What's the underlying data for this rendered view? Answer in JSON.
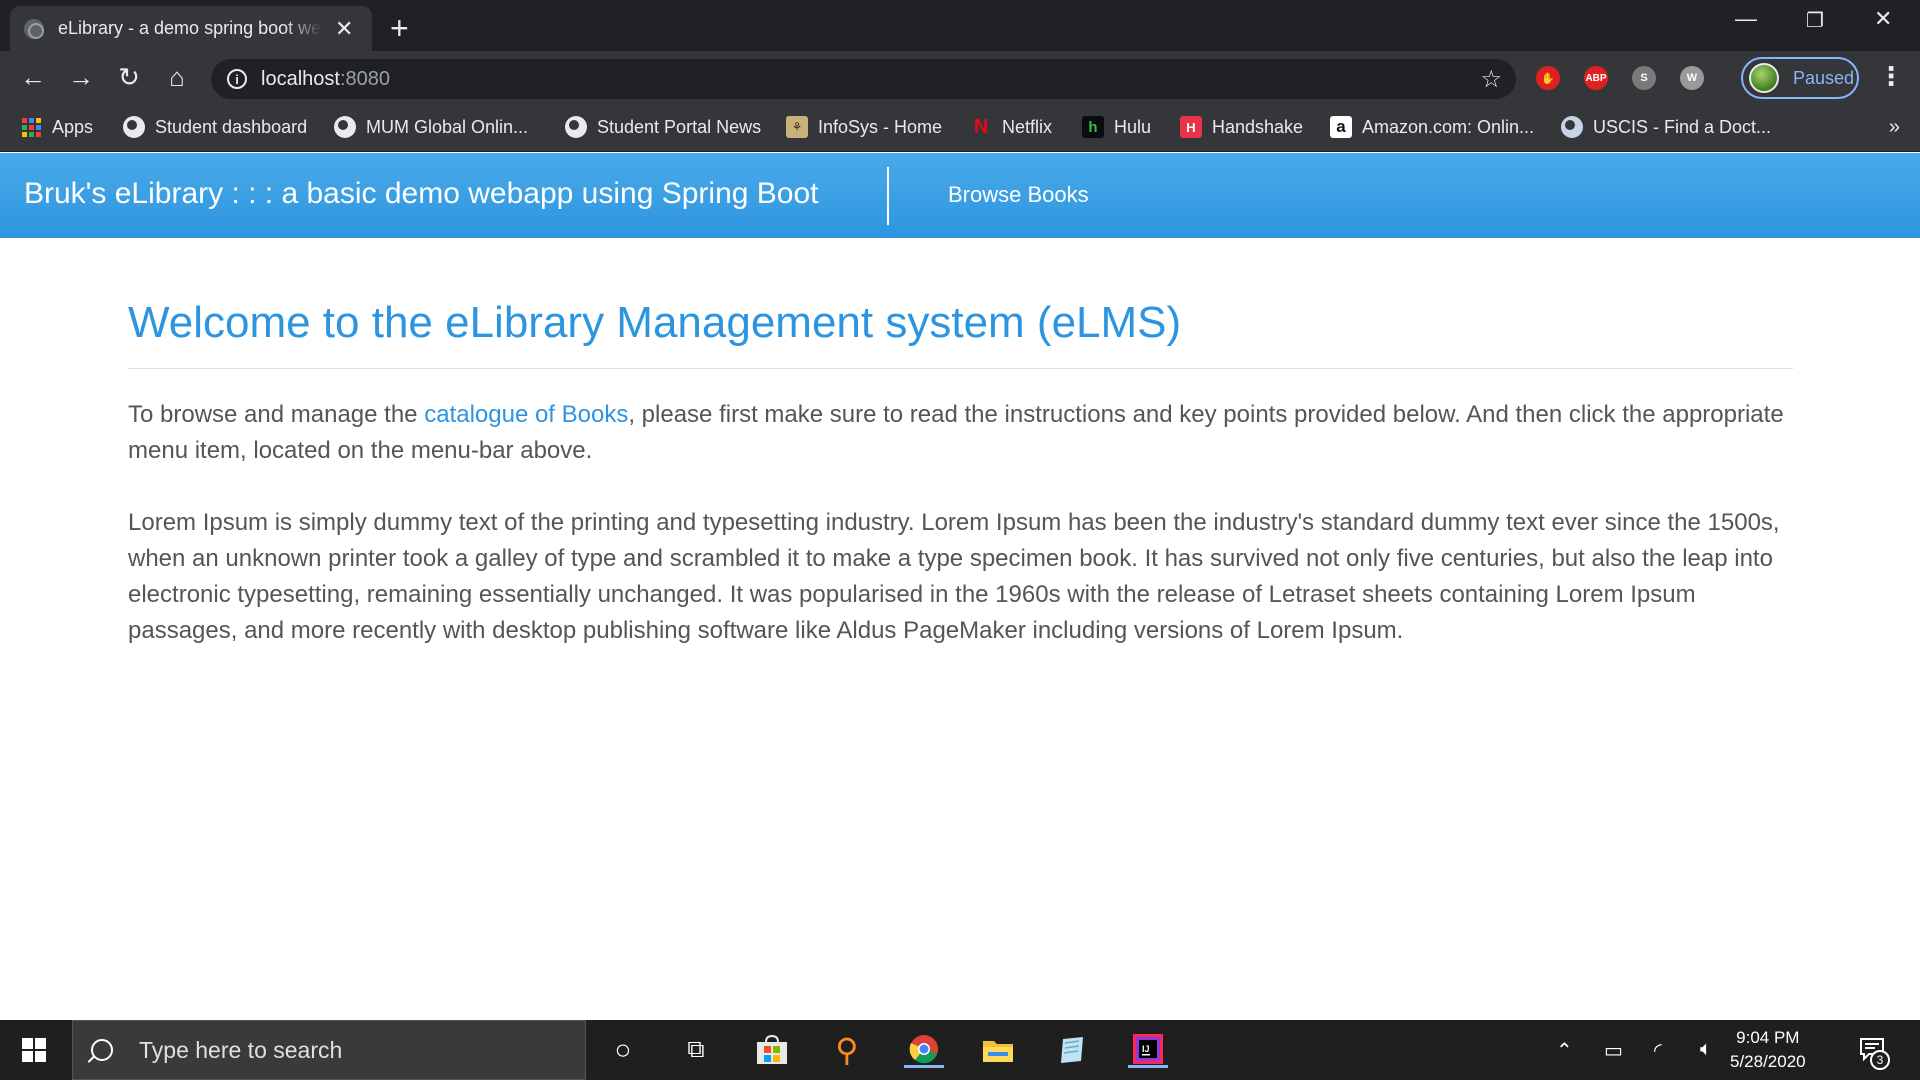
{
  "browser": {
    "tab_title": "eLibrary - a demo spring boot web app",
    "tab_close": "✕",
    "new_tab": "+",
    "window_controls": {
      "minimize": "—",
      "restore": "❐",
      "close": "✕"
    },
    "toolbar": {
      "back": "←",
      "forward": "→",
      "reload": "↻",
      "home": "⌂",
      "info_glyph": "i",
      "url_host": "localhost",
      "url_port": ":8080",
      "star": "☆",
      "extensions": [
        {
          "icon": "hand-stop-icon",
          "label": "",
          "color": "#e02020"
        },
        {
          "icon": "adblock-plus-icon",
          "label": "ABP",
          "color": "#e02020"
        },
        {
          "icon": "s-extension-icon",
          "label": "S",
          "color": "#7a7a7a"
        },
        {
          "icon": "w-extension-icon",
          "label": "W",
          "color": "#9a9a9a"
        }
      ],
      "profile_status": "Paused",
      "menu": "⋮"
    },
    "bookmarks": {
      "items": [
        {
          "label": "Apps",
          "icon": "apps-grid-icon"
        },
        {
          "label": "Student dashboard",
          "icon": "globe-icon"
        },
        {
          "label": "MUM Global Onlin...",
          "icon": "globe-icon"
        },
        {
          "label": "Student Portal News",
          "icon": "globe-icon"
        },
        {
          "label": "InfoSys - Home",
          "icon": "infosys-icon"
        },
        {
          "label": "Netflix",
          "icon": "netflix-icon"
        },
        {
          "label": "Hulu",
          "icon": "hulu-icon"
        },
        {
          "label": "Handshake",
          "icon": "handshake-icon"
        },
        {
          "label": "Amazon.com: Onlin...",
          "icon": "amazon-icon"
        },
        {
          "label": "USCIS - Find a Doct...",
          "icon": "uscis-icon"
        }
      ],
      "more": "»"
    }
  },
  "site": {
    "brand": "Bruk's eLibrary : : : a basic demo webapp using Spring Boot",
    "nav_link": "Browse Books",
    "heading": "Welcome to the eLibrary Management system (eLMS)",
    "intro_before": "To browse and manage the ",
    "intro_link": "catalogue of Books",
    "intro_after": ", please first make sure to read the instructions and key points provided below. And then click the appropriate menu item, located on the menu-bar above.",
    "lorem": "Lorem Ipsum is simply dummy text of the printing and typesetting industry. Lorem Ipsum has been the industry's standard dummy text ever since the 1500s, when an unknown printer took a galley of type and scrambled it to make a type specimen book. It has survived not only five centuries, but also the leap into electronic typesetting, remaining essentially unchanged. It was popularised in the 1960s with the release of Letraset sheets containing Lorem Ipsum passages, and more recently with desktop publishing software like Aldus PageMaker including versions of Lorem Ipsum."
  },
  "taskbar": {
    "search_placeholder": "Type here to search",
    "time": "9:04 PM",
    "date": "5/28/2020",
    "notification_count": "3"
  },
  "colors": {
    "accent": "#2d95e0",
    "navbar": "#3aa0e6",
    "body_text": "#555555"
  }
}
